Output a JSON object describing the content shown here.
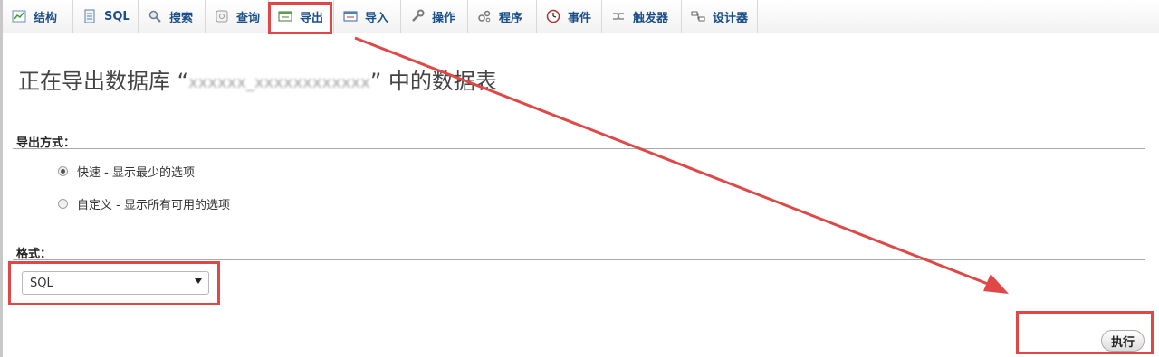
{
  "tabs": [
    {
      "label": "结构",
      "icon": "structure-icon"
    },
    {
      "label": "SQL",
      "icon": "sql-icon"
    },
    {
      "label": "搜索",
      "icon": "search-icon"
    },
    {
      "label": "查询",
      "icon": "query-icon"
    },
    {
      "label": "导出",
      "icon": "export-icon",
      "active": true
    },
    {
      "label": "导入",
      "icon": "import-icon"
    },
    {
      "label": "操作",
      "icon": "wrench-icon"
    },
    {
      "label": "程序",
      "icon": "routines-icon"
    },
    {
      "label": "事件",
      "icon": "clock-icon"
    },
    {
      "label": "触发器",
      "icon": "triggers-icon"
    },
    {
      "label": "设计器",
      "icon": "designer-icon"
    }
  ],
  "page": {
    "title_prefix": "正在导出数据库 “",
    "db_name_blurred": "xxxxxx_xxxxxxxxxxxx",
    "title_suffix": "” 中的数据表"
  },
  "export_method": {
    "label": "导出方式：",
    "options": [
      {
        "label": "快速 - 显示最少的选项",
        "checked": true
      },
      {
        "label": "自定义 - 显示所有可用的选项",
        "checked": false
      }
    ]
  },
  "format": {
    "label": "格式：",
    "selected": "SQL"
  },
  "actions": {
    "go_label": "执行"
  },
  "annotation_color": "#e04848"
}
